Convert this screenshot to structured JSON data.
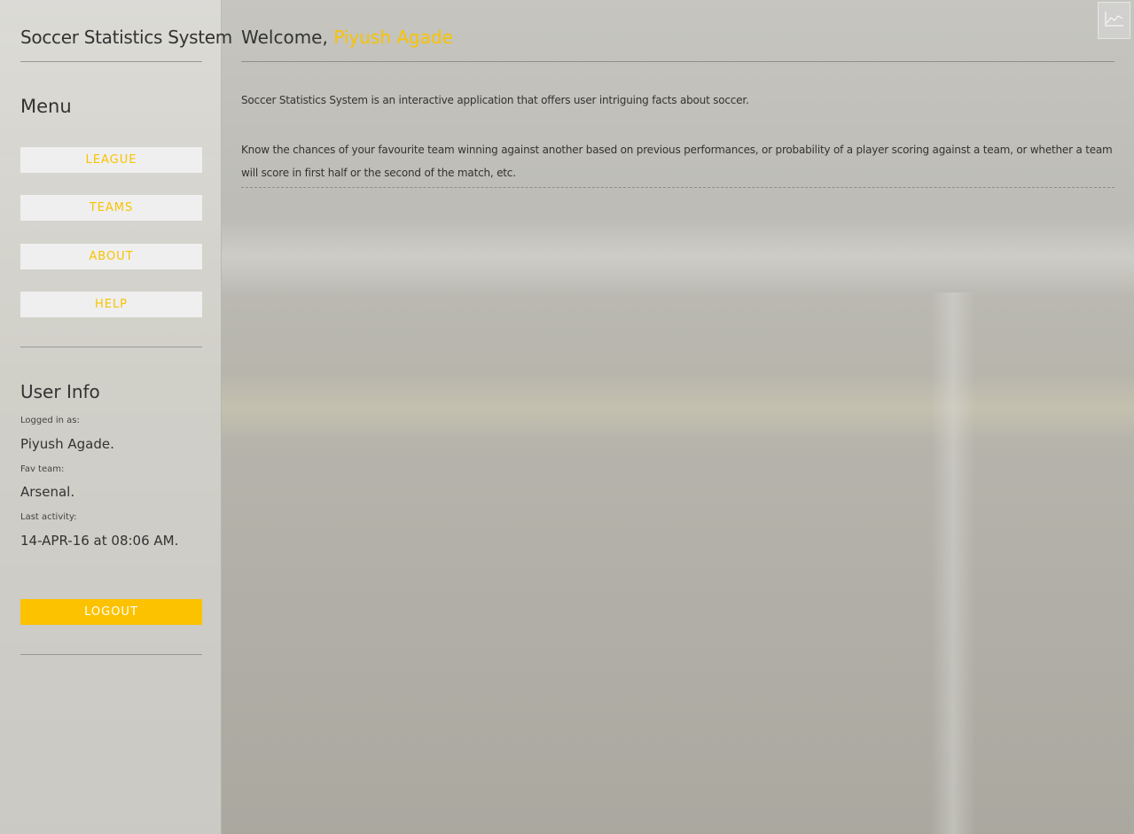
{
  "app": {
    "title": "Soccer Statistics System"
  },
  "menu": {
    "title": "Menu",
    "items": [
      {
        "label": "LEAGUE"
      },
      {
        "label": "TEAMS"
      },
      {
        "label": "ABOUT"
      },
      {
        "label": "HELP"
      }
    ]
  },
  "user_info": {
    "title": "User Info",
    "logged_in_label": "Logged in as:",
    "logged_in_value": "Piyush Agade.",
    "fav_team_label": "Fav team:",
    "fav_team_value": "Arsenal.",
    "last_activity_label": "Last activity:",
    "last_activity_value": "14-APR-16 at 08:06 AM.",
    "logout_label": "LOGOUT"
  },
  "main": {
    "welcome_prefix": "Welcome,",
    "welcome_name": "Piyush Agade",
    "paragraph1": "Soccer Statistics System is an interactive application that offers user intriguing facts about soccer.",
    "paragraph2": "Know the chances of your favourite team winning against another based on previous performances, or probability of a player scoring against a team, or whether a team will score in first half or the second of the match, etc."
  },
  "icons": {
    "chart_button": "line-chart-icon"
  },
  "colors": {
    "accent": "#f8c300",
    "logout_bg": "#fcc200",
    "menu_button_bg": "#efefef"
  }
}
